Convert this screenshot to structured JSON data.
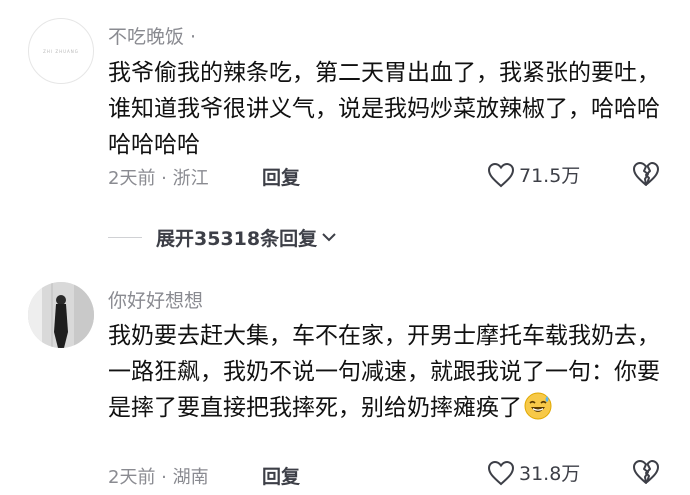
{
  "comments": [
    {
      "username": "不吃晚饭 ·",
      "avatar_text": "ZHI ZHUANG",
      "text": "我爷偷我的辣条吃，第二天胃出血了，我紧张的要吐，谁知道我爷很讲义气，说是我妈炒菜放辣椒了，哈哈哈哈哈哈哈",
      "time_location": "2天前 · 浙江",
      "reply_label": "回复",
      "likes": "71.5万"
    },
    {
      "username": "你好好想想",
      "text": "我奶要去赶大集，车不在家，开男士摩托车载我奶去，一路狂飙，我奶不说一句减速，就跟我说了一句：你要是摔了要直接把我摔死，别给奶摔瘫痪了",
      "time_location": "2天前 · 湖南",
      "reply_label": "回复",
      "likes": "31.8万"
    }
  ],
  "expand_replies_label": "展开35318条回复",
  "icons": {
    "like": "heart-outline-icon",
    "dislike": "broken-heart-icon",
    "expand": "chevron-down-icon",
    "emoji": "sweat-smile-emoji"
  }
}
